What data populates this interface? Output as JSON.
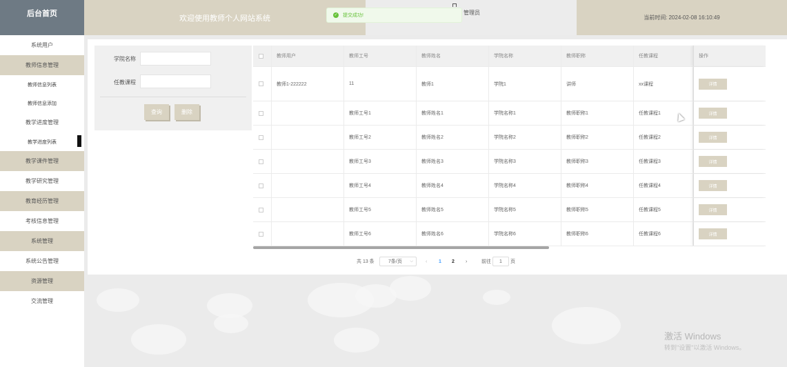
{
  "header": {
    "brand": "后台首页",
    "welcome": "欢迎使用教师个人网站系统",
    "user": "管理员",
    "time_label": "当前时间:",
    "time_value": "2024-02-08 16:10:49"
  },
  "toast": {
    "message": "提交成功!",
    "icon": "check-circle-icon",
    "color": "#67c23a"
  },
  "colors": {
    "accent": "#d9d3c2",
    "brand_bg": "#6e7a84",
    "link": "#409eff"
  },
  "sidebar": {
    "items": [
      {
        "label": "系统用户",
        "style": "plain"
      },
      {
        "label": "教师信息管理",
        "style": "tan"
      },
      {
        "label": "教师信息列表",
        "style": "sub"
      },
      {
        "label": "教师信息添加",
        "style": "sub"
      },
      {
        "label": "教学进度管理",
        "style": "plain"
      },
      {
        "label": "教学进度列表",
        "style": "sub-active"
      },
      {
        "label": "教学课件管理",
        "style": "tan"
      },
      {
        "label": "教学研究管理",
        "style": "plain"
      },
      {
        "label": "教育经历管理",
        "style": "tan"
      },
      {
        "label": "考核信息管理",
        "style": "plain"
      },
      {
        "label": "系统管理",
        "style": "tan"
      },
      {
        "label": "系统公告管理",
        "style": "plain"
      },
      {
        "label": "资源管理",
        "style": "tan"
      },
      {
        "label": "交流管理",
        "style": "plain"
      }
    ]
  },
  "search": {
    "college_label": "学院名称",
    "college_value": "",
    "course_label": "任教课程",
    "course_value": "",
    "query_button": "查询",
    "delete_button": "删除"
  },
  "table": {
    "columns": [
      "教师用户",
      "教师工号",
      "教师姓名",
      "学院名称",
      "教师职称",
      "任教课程",
      "操作"
    ],
    "rows": [
      {
        "user": "教师1-222222",
        "no": "11",
        "name": "教师1",
        "college": "学院1",
        "title": "讲师",
        "course": "xx课程",
        "action": "详情"
      },
      {
        "user": "",
        "no": "教师工号1",
        "name": "教师姓名1",
        "college": "学院名称1",
        "title": "教师职称1",
        "course": "任教课程1",
        "action": "详情"
      },
      {
        "user": "",
        "no": "教师工号2",
        "name": "教师姓名2",
        "college": "学院名称2",
        "title": "教师职称2",
        "course": "任教课程2",
        "action": "详情"
      },
      {
        "user": "",
        "no": "教师工号3",
        "name": "教师姓名3",
        "college": "学院名称3",
        "title": "教师职称3",
        "course": "任教课程3",
        "action": "详情"
      },
      {
        "user": "",
        "no": "教师工号4",
        "name": "教师姓名4",
        "college": "学院名称4",
        "title": "教师职称4",
        "course": "任教课程4",
        "action": "详情"
      },
      {
        "user": "",
        "no": "教师工号5",
        "name": "教师姓名5",
        "college": "学院名称5",
        "title": "教师职称5",
        "course": "任教课程5",
        "action": "详情"
      },
      {
        "user": "",
        "no": "教师工号6",
        "name": "教师姓名6",
        "college": "学院名称6",
        "title": "教师职称6",
        "course": "任教课程6",
        "action": "详情"
      }
    ]
  },
  "pagination": {
    "total": "共 13 条",
    "page_size": "7条/页",
    "prev": "‹",
    "pages": [
      "1",
      "2"
    ],
    "current_page": "1",
    "next": "›",
    "goto_label": "前往",
    "goto_value": "1",
    "goto_suffix": "页"
  },
  "watermark": {
    "line1": "激活 Windows",
    "line2": "转到\"设置\"以激活 Windows。"
  }
}
